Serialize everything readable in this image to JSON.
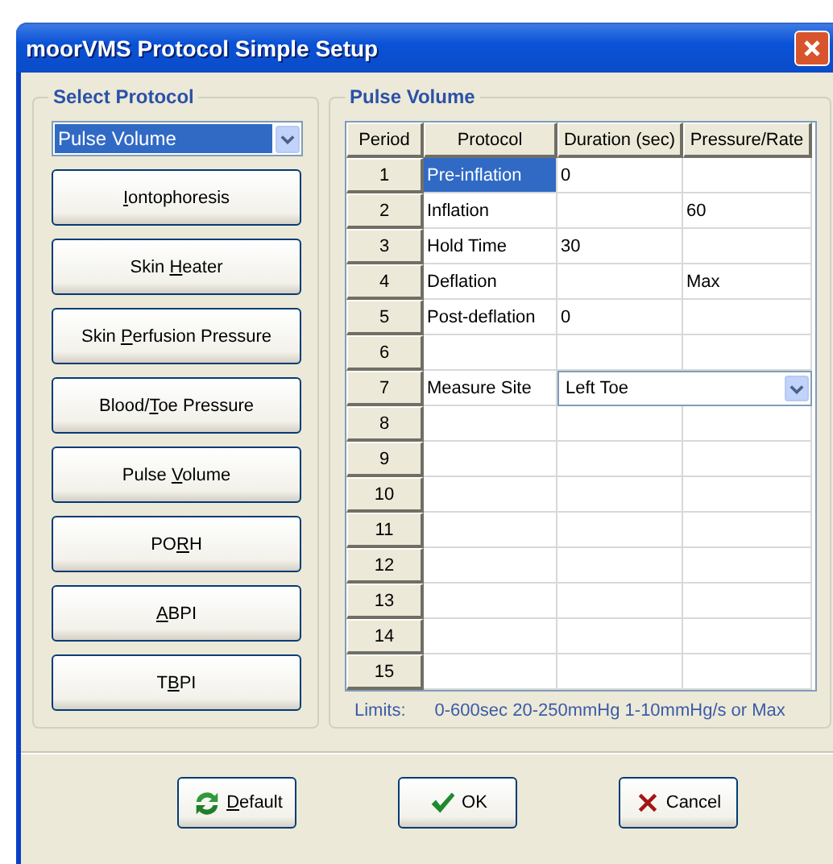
{
  "window": {
    "title": "moorVMS Protocol Simple Setup"
  },
  "select_protocol": {
    "title": "Select Protocol",
    "dropdown": {
      "value": "Pulse Volume"
    },
    "buttons": [
      {
        "key": "I",
        "post": "ontophoresis"
      },
      {
        "pre": "Skin ",
        "key": "H",
        "post": "eater"
      },
      {
        "pre": "Skin ",
        "key": "P",
        "post": "erfusion Pressure"
      },
      {
        "pre": "Blood/",
        "key": "T",
        "post": "oe Pressure"
      },
      {
        "pre": "Pulse ",
        "key": "V",
        "post": "olume"
      },
      {
        "pre": "PO",
        "key": "R",
        "post": "H"
      },
      {
        "key": "A",
        "post": "BPI"
      },
      {
        "pre": "T",
        "key": "B",
        "post": "PI"
      }
    ]
  },
  "pulse_volume": {
    "title": "Pulse Volume",
    "table": {
      "columns": [
        "Period",
        "Protocol",
        "Duration (sec)",
        "Pressure/Rate"
      ],
      "rows": [
        {
          "kind": "text",
          "period": "1",
          "protocol": "Pre-inflation",
          "duration": "0",
          "selected": true
        },
        {
          "kind": "text",
          "period": "2",
          "protocol": "Inflation",
          "pressure": "60",
          "selected": false
        },
        {
          "kind": "text",
          "period": "3",
          "protocol": "Hold Time",
          "duration": "30",
          "selected": false
        },
        {
          "kind": "text",
          "period": "4",
          "protocol": "Deflation",
          "pressure": "Max",
          "selected": false
        },
        {
          "kind": "text",
          "period": "5",
          "protocol": "Post-deflation",
          "duration": "0",
          "selected": false
        },
        {
          "kind": "text",
          "period": "6",
          "selected": false
        },
        {
          "kind": "select",
          "period": "7",
          "protocol": "Measure Site",
          "value": "Left Toe",
          "selected": false
        },
        {
          "kind": "text",
          "period": "8",
          "selected": false
        },
        {
          "kind": "text",
          "period": "9",
          "selected": false
        },
        {
          "kind": "text",
          "period": "10",
          "selected": false
        },
        {
          "kind": "text",
          "period": "11",
          "selected": false
        },
        {
          "kind": "text",
          "period": "12",
          "selected": false
        },
        {
          "kind": "text",
          "period": "13",
          "selected": false
        },
        {
          "kind": "text",
          "period": "14",
          "selected": false
        },
        {
          "kind": "text",
          "period": "15",
          "selected": false
        }
      ]
    },
    "limits": {
      "label": "Limits:",
      "values": "0-600sec  20-250mmHg  1-10mmHg/s or Max"
    }
  },
  "buttons": [
    {
      "kind": "default",
      "key": "D",
      "post": "efault"
    },
    {
      "kind": "ok",
      "pre": "OK"
    },
    {
      "kind": "cancel",
      "pre": "Cancel"
    }
  ]
}
